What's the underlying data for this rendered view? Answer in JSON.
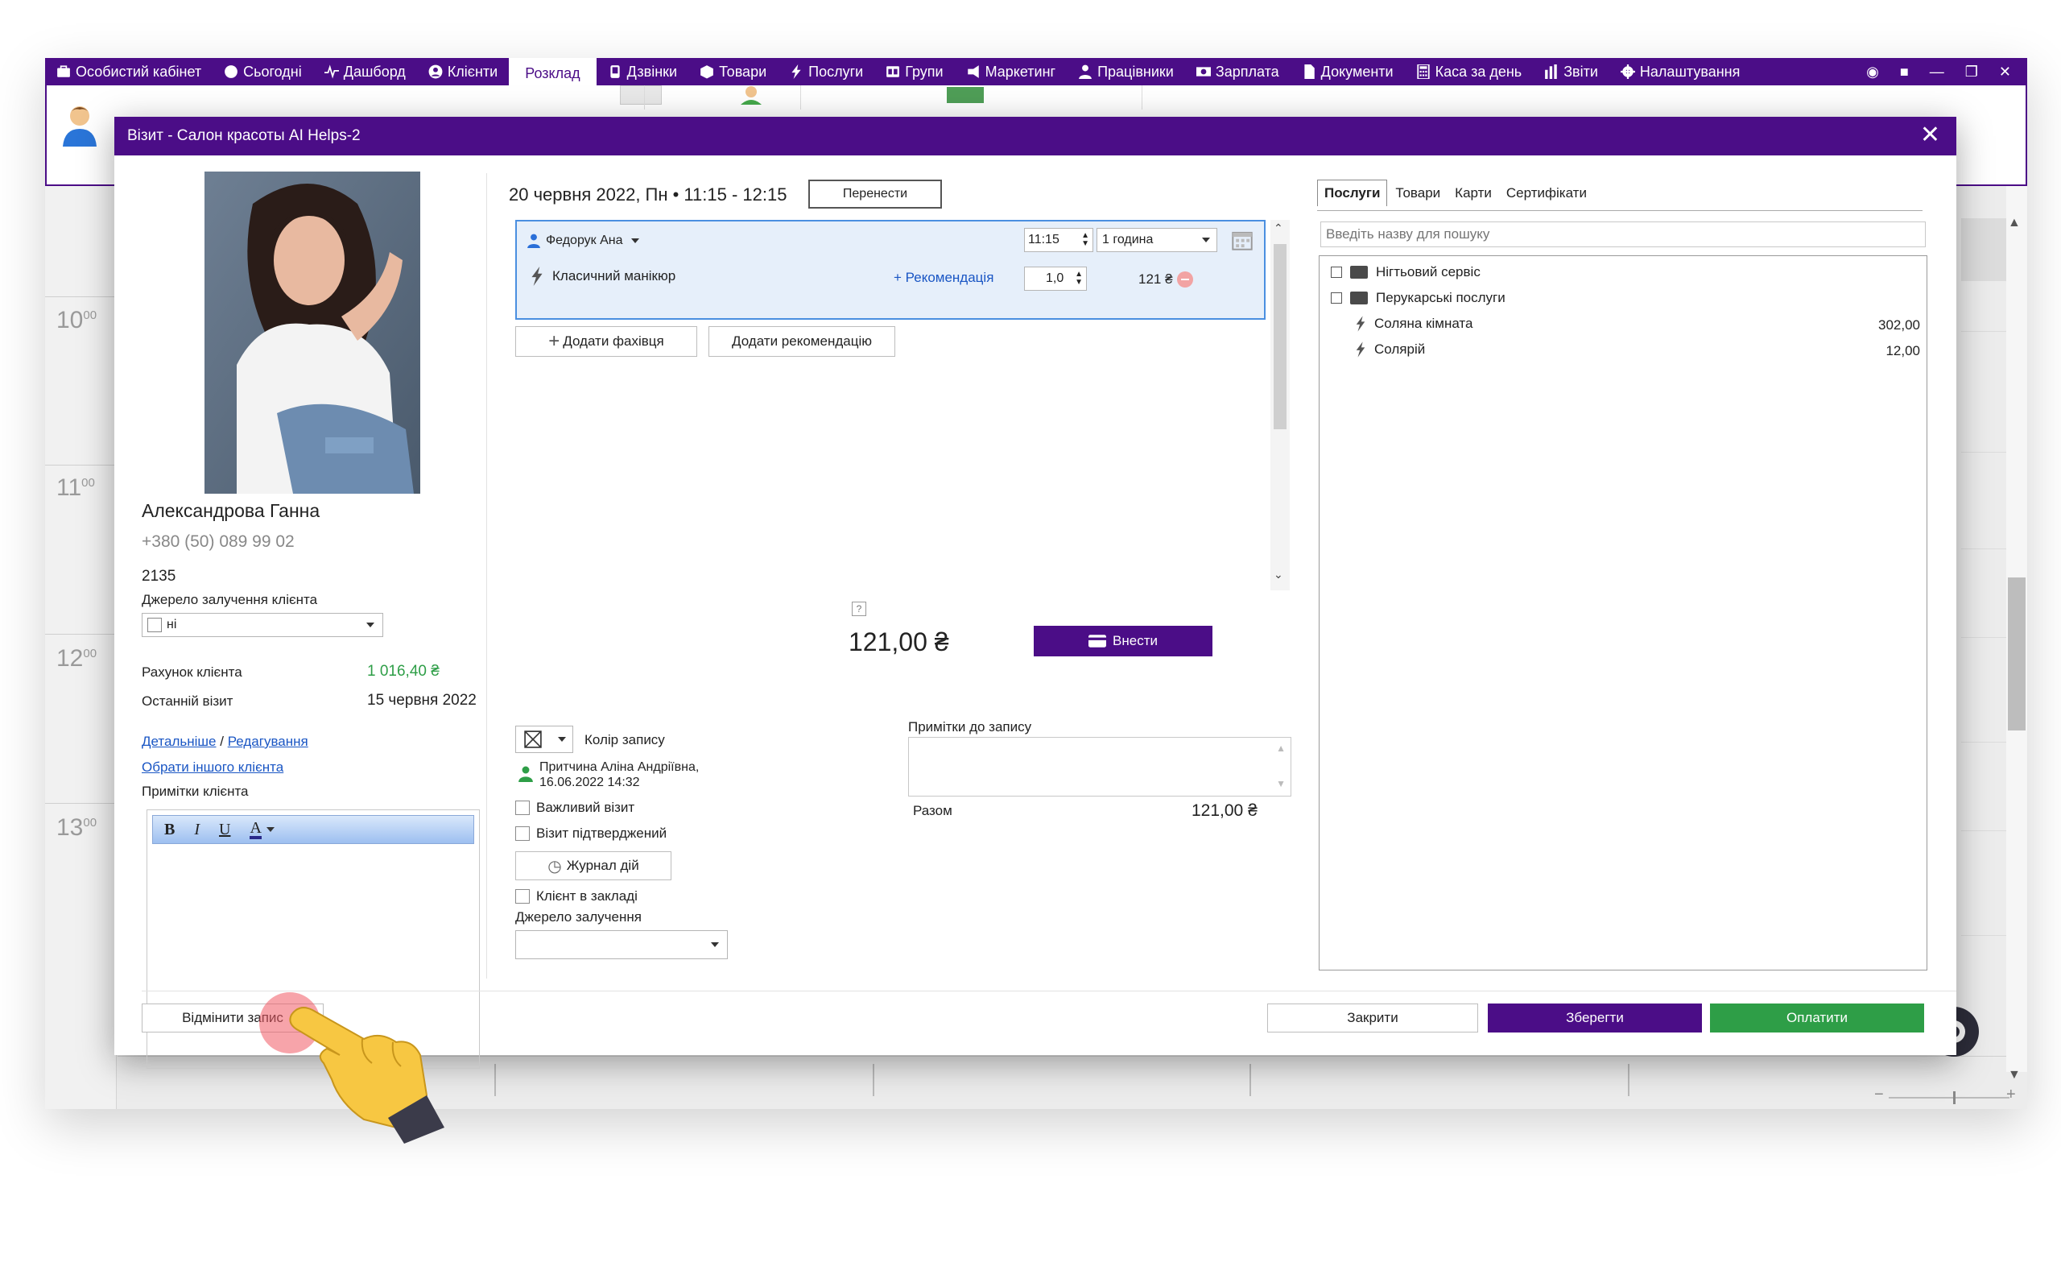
{
  "topnav": {
    "items": [
      {
        "label": "Особистий кабінет",
        "icon": "briefcase-icon"
      },
      {
        "label": "Сьогодні",
        "icon": "today-icon"
      },
      {
        "label": "Дашборд",
        "icon": "pulse-icon"
      },
      {
        "label": "Клієнти",
        "icon": "user-icon"
      },
      {
        "label": "Розклад",
        "icon": "",
        "active": true
      },
      {
        "label": "Дзвінки",
        "icon": "phone-icon"
      },
      {
        "label": "Товари",
        "icon": "box-icon"
      },
      {
        "label": "Послуги",
        "icon": "lightning-icon"
      },
      {
        "label": "Групи",
        "icon": "groups-icon"
      },
      {
        "label": "Маркетинг",
        "icon": "megaphone-icon"
      },
      {
        "label": "Працівники",
        "icon": "person-icon"
      },
      {
        "label": "Зарплата",
        "icon": "money-icon"
      },
      {
        "label": "Документи",
        "icon": "document-icon"
      },
      {
        "label": "Каса за день",
        "icon": "calculator-icon"
      },
      {
        "label": "Звіти",
        "icon": "bar-chart-icon"
      },
      {
        "label": "Налаштування",
        "icon": "gear-icon"
      }
    ]
  },
  "schedule": {
    "hours": [
      "10",
      "11",
      "12",
      "13"
    ],
    "minutes": "00"
  },
  "dialog": {
    "title": "Візит - Салон красоты AI Helps-2",
    "client": {
      "name": "Александрова Ганна",
      "phone": "+380 (50) 089 99 02",
      "card_number": "2135",
      "source_label": "Джерело залучення клієнта",
      "source_value": "ні",
      "balance_label": "Рахунок клієнта",
      "balance_value": "1 016,40 ₴",
      "last_visit_label": "Останній візит",
      "last_visit_value": "15 червня 2022",
      "details_link": "Детальніше",
      "link_separator": "/",
      "edit_link": "Редагування",
      "other_client_link": "Обрати іншого клієнта",
      "notes_label": "Примітки клієнта",
      "editor": {
        "bold": "B",
        "italic": "I",
        "underline": "U",
        "color": "A"
      }
    },
    "visit": {
      "datetime": "20 червня 2022, Пн • 11:15 - 12:15",
      "move_button": "Перенести",
      "specialist": "Федорук Ана",
      "start_time": "11:15",
      "duration": "1 година",
      "service": "Класичний манікюр",
      "recommendation": "+ Рекомендація",
      "quantity": "1,0",
      "price": "121 ₴",
      "add_specialist": "Додати фахівця",
      "add_recommendation": "Додати рекомендацію",
      "help_mark": "?",
      "total": "121,00 ₴",
      "pay_in_button": "Внести",
      "color_label": "Колір запису",
      "created_by": "Притчина Аліна Андріївна,",
      "created_at": "16.06.2022 14:32",
      "important": "Важливий візит",
      "confirmed": "Візит підтверджений",
      "log_button": "Журнал дій",
      "client_in_place": "Клієнт в закладі",
      "source_label": "Джерело залучення",
      "notes_label": "Примітки до запису",
      "sum_label": "Разом",
      "sum_value": "121,00 ₴"
    },
    "catalog": {
      "tabs": [
        "Послуги",
        "Товари",
        "Карти",
        "Сертифікати"
      ],
      "search_placeholder": "Введіть назву для пошуку",
      "folders": [
        "Нігтьовий сервіс",
        "Перукарські послуги"
      ],
      "services": [
        {
          "name": "Соляна кімната",
          "price": "302,00"
        },
        {
          "name": "Солярій",
          "price": "12,00"
        }
      ]
    },
    "footer": {
      "cancel_visit": "Відмінити запис",
      "close": "Закрити",
      "save": "Зберегти",
      "pay": "Оплатити"
    }
  },
  "colors": {
    "brand_purple": "#4b0d87",
    "pay_green": "#2e9e47",
    "balance_green": "#2e9e47",
    "link_blue": "#1a56c4"
  }
}
